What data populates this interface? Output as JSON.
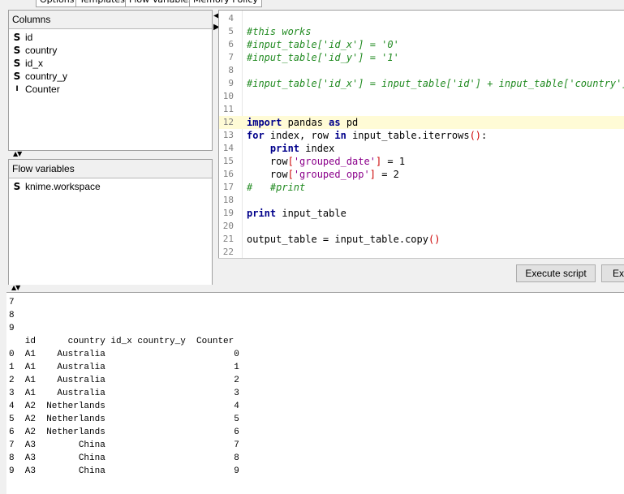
{
  "top_tabs": [
    "Options",
    "Templates",
    "Flow Variables",
    "Memory Policy"
  ],
  "columns_panel": {
    "title": "Columns",
    "items": [
      {
        "type": "S",
        "name": "id"
      },
      {
        "type": "S",
        "name": "country"
      },
      {
        "type": "S",
        "name": "id_x"
      },
      {
        "type": "S",
        "name": "country_y"
      },
      {
        "type": "I",
        "name": "Counter"
      }
    ]
  },
  "flow_panel": {
    "title": "Flow variables",
    "items": [
      {
        "type": "S",
        "name": "knime.workspace"
      }
    ]
  },
  "editor": {
    "lines": [
      {
        "n": "4",
        "text": ""
      },
      {
        "n": "5",
        "text": "#this works"
      },
      {
        "n": "6",
        "text": "#input_table['id_x'] = '0'"
      },
      {
        "n": "7",
        "text": "#input_table['id_y'] = '1'"
      },
      {
        "n": "8",
        "text": ""
      },
      {
        "n": "9",
        "text": "#input_table['id_x'] = input_table['id'] + input_table['country']"
      },
      {
        "n": "10",
        "text": ""
      },
      {
        "n": "11",
        "text": ""
      },
      {
        "n": "12",
        "text": "import pandas as pd"
      },
      {
        "n": "13",
        "text": "for index, row in input_table.iterrows():"
      },
      {
        "n": "14",
        "text": "    print index"
      },
      {
        "n": "15",
        "text": "    row['grouped_date'] = 1"
      },
      {
        "n": "16",
        "text": "    row['grouped_opp'] = 2"
      },
      {
        "n": "17",
        "text": "#   #print"
      },
      {
        "n": "18",
        "text": ""
      },
      {
        "n": "19",
        "text": "print input_table"
      },
      {
        "n": "20",
        "text": ""
      },
      {
        "n": "21",
        "text": "output_table = input_table.copy()"
      },
      {
        "n": "22",
        "text": ""
      }
    ],
    "highlight_line": "12"
  },
  "buttons": {
    "execute_script": "Execute script",
    "execute_selected": "Ex"
  },
  "console": {
    "text": "7\n8\n9\n   id      country id_x country_y  Counter\n0  A1    Australia                        0\n1  A1    Australia                        1\n2  A1    Australia                        2\n3  A1    Australia                        3\n4  A2  Netherlands                        4\n5  A2  Netherlands                        5\n6  A2  Netherlands                        6\n7  A3        China                        7\n8  A3        China                        8\n9  A3        China                        9"
  },
  "colors": {
    "keyword": "#00008b",
    "comment": "#228b22",
    "string": "#8b008b",
    "highlight": "#fffbd6"
  }
}
